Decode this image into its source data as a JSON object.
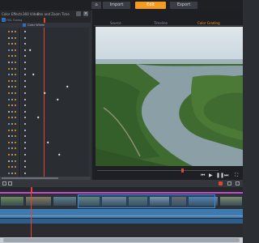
{
  "modes": {
    "import": "Import",
    "edit": "Edit",
    "export": "Export"
  },
  "colors": {
    "accent": "#f39a1f",
    "selection": "#2f6fb7",
    "playhead": "#e0452f"
  },
  "left_panel": {
    "tabs": [
      "Color",
      "Effects",
      "360 Video",
      "Pan and Zoom",
      "Time"
    ],
    "sub_header": "HSL Tuning",
    "section_label": "Color Wheel"
  },
  "viewer": {
    "tabs": [
      "Source",
      "Timeline",
      "Color Grading"
    ],
    "active_tab": "Color Grading"
  },
  "icons": [
    "home-icon",
    "play-icon",
    "pause-icon",
    "skip-back-icon",
    "skip-forward-icon",
    "fullscreen-icon",
    "close-icon",
    "menu-icon"
  ]
}
